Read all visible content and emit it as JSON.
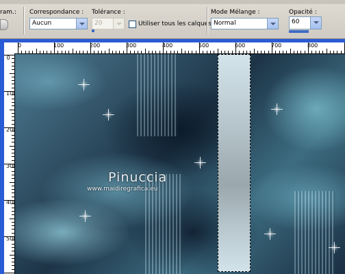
{
  "toolbar": {
    "truncated_label": "ram.:",
    "correspondance": {
      "label": "Correspondance :",
      "value": "Aucun"
    },
    "tolerance": {
      "label": "Tolérance :",
      "value": "20"
    },
    "all_layers": {
      "label": "Utiliser tous les calques",
      "checked": false
    },
    "blend_mode": {
      "label": "Mode Mélange :",
      "value": "Normal"
    },
    "opacity": {
      "label": "Opacité :",
      "value": "60"
    }
  },
  "rulers": {
    "horizontal": [
      "0",
      "100",
      "200",
      "300",
      "400",
      "500",
      "600",
      "700",
      "800"
    ],
    "vertical": [
      "0",
      "100",
      "200",
      "300",
      "400",
      "500"
    ]
  },
  "canvas": {
    "watermark_name": "Pinuccia",
    "watermark_url": "www.maidiregrafica.eu"
  }
}
